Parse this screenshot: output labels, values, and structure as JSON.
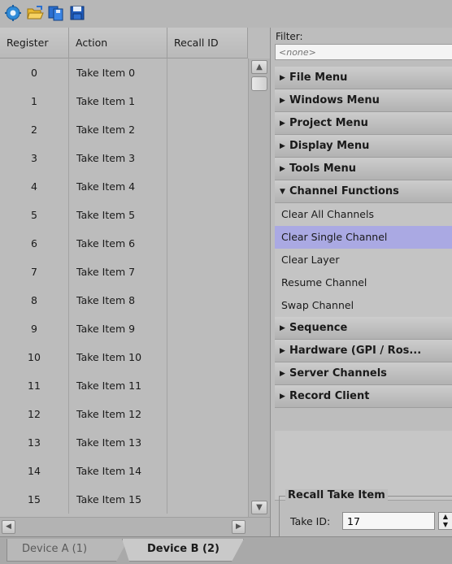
{
  "toolbar": {
    "buttons": [
      {
        "name": "settings-gear-icon",
        "color": "#2f8bd8"
      },
      {
        "name": "open-folder-icon",
        "color": "#e8b830"
      },
      {
        "name": "copy-icon",
        "color": "#2a6fd0"
      },
      {
        "name": "save-icon",
        "color": "#1f5ab8"
      }
    ]
  },
  "grid": {
    "columns": [
      "Register",
      "Action",
      "Recall ID"
    ],
    "rows": [
      {
        "register": "0",
        "action": "Take Item 0",
        "recall_id": ""
      },
      {
        "register": "1",
        "action": "Take Item 1",
        "recall_id": ""
      },
      {
        "register": "2",
        "action": "Take Item 2",
        "recall_id": ""
      },
      {
        "register": "3",
        "action": "Take Item 3",
        "recall_id": ""
      },
      {
        "register": "4",
        "action": "Take Item 4",
        "recall_id": ""
      },
      {
        "register": "5",
        "action": "Take Item 5",
        "recall_id": ""
      },
      {
        "register": "6",
        "action": "Take Item 6",
        "recall_id": ""
      },
      {
        "register": "7",
        "action": "Take Item 7",
        "recall_id": ""
      },
      {
        "register": "8",
        "action": "Take Item 8",
        "recall_id": ""
      },
      {
        "register": "9",
        "action": "Take Item 9",
        "recall_id": ""
      },
      {
        "register": "10",
        "action": "Take Item 10",
        "recall_id": ""
      },
      {
        "register": "11",
        "action": "Take Item 11",
        "recall_id": ""
      },
      {
        "register": "12",
        "action": "Take Item 12",
        "recall_id": ""
      },
      {
        "register": "13",
        "action": "Take Item 13",
        "recall_id": ""
      },
      {
        "register": "14",
        "action": "Take Item 14",
        "recall_id": ""
      },
      {
        "register": "15",
        "action": "Take Item 15",
        "recall_id": ""
      }
    ]
  },
  "panel": {
    "filter_label": "Filter:",
    "filter_placeholder": "<none>",
    "items": [
      {
        "type": "category",
        "label": "File Menu",
        "expanded": false
      },
      {
        "type": "category",
        "label": "Windows Menu",
        "expanded": false
      },
      {
        "type": "category",
        "label": "Project Menu",
        "expanded": false
      },
      {
        "type": "category",
        "label": "Display Menu",
        "expanded": false
      },
      {
        "type": "category",
        "label": "Tools Menu",
        "expanded": false
      },
      {
        "type": "category",
        "label": "Channel Functions",
        "expanded": true
      },
      {
        "type": "item",
        "label": "Clear All Channels",
        "selected": false
      },
      {
        "type": "item",
        "label": "Clear Single Channel",
        "selected": true
      },
      {
        "type": "item",
        "label": "Clear Layer",
        "selected": false
      },
      {
        "type": "item",
        "label": "Resume Channel",
        "selected": false
      },
      {
        "type": "item",
        "label": "Swap Channel",
        "selected": false
      },
      {
        "type": "category",
        "label": "Sequence",
        "expanded": false
      },
      {
        "type": "category",
        "label": "Hardware (GPI / Ros...",
        "expanded": false
      },
      {
        "type": "category",
        "label": "Server Channels",
        "expanded": false
      },
      {
        "type": "category",
        "label": "Record Client",
        "expanded": false
      }
    ],
    "recall": {
      "title": "Recall Take Item",
      "take_id_label": "Take ID:",
      "take_id_value": "17"
    }
  },
  "tabs": [
    {
      "label": "Device A (1)",
      "active": false
    },
    {
      "label": "Device B (2)",
      "active": true
    }
  ],
  "colors": {
    "selection": "#aaa9e3",
    "background": "#bcbcbc"
  }
}
